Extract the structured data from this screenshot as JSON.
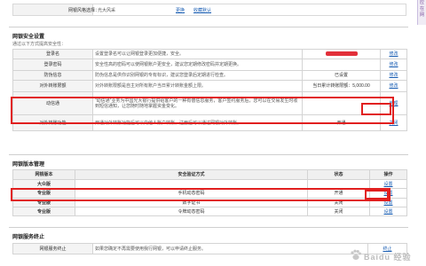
{
  "top": {
    "label": "网银风格选择：",
    "value": "光大风采",
    "link_change": "更换",
    "link_favorites": "收藏默认"
  },
  "sidewidget": {
    "chars": [
      "应",
      "在",
      "网"
    ]
  },
  "security": {
    "title": "网银安全设置",
    "subtitle": "通过以下方式提高安全性：",
    "rows": [
      {
        "label": "登录名",
        "desc": "设置登录名可以让网银登录更加便捷，安全。",
        "status_redacted": true,
        "op": "修改"
      },
      {
        "label": "登录密码",
        "desc": "安全性高的密码可以使网银账户更安全，建议您定期修改密码并定期更换。",
        "status": "",
        "op": "修改"
      },
      {
        "label": "防伪信息",
        "desc": "防伪信息是供你识别网银的专有标识，建议您登录后定期进行检查。",
        "status": "已设置",
        "op": "修改"
      },
      {
        "label": "对外转账限额",
        "desc": "对外转账限额是自主对所有账户当日累计转账金额上限。",
        "status": "当日累计转账限额：5,000.00",
        "op": "修改"
      },
      {
        "label": "动信通",
        "desc": "“动信通”业务为中国光大银行提供给客户的一种有偿信息服务，客户签约服务后，您可以在交易发生时收到短信通知，让您随时随地掌握资金变化。",
        "status": "",
        "op": "管理"
      },
      {
        "label": "对外转账功能",
        "desc": "开通对外转账功能后可以向他人账户转账，注册后可以通过网银对外转账。",
        "status": "开通",
        "op": "关闭"
      }
    ]
  },
  "version": {
    "title": "网银版本管理",
    "headers": [
      "网银版本",
      "安全验证方式",
      "状态",
      "操作"
    ],
    "rows": [
      {
        "name": "大众版",
        "method": "",
        "status": "",
        "op": "设置"
      },
      {
        "name": "专业版",
        "method": "手机动态密码",
        "status": "开通",
        "op": "设置"
      },
      {
        "name": "专业版",
        "method": "数字证书",
        "status": "关闭",
        "op": "设置"
      },
      {
        "name": "专业版",
        "method": "令牌动态密码",
        "status": "关闭",
        "op": "设置"
      }
    ]
  },
  "termination": {
    "title": "网银服务终止",
    "row": {
      "label": "网银服务终止",
      "desc": "如果您确定不再需要使用我行网银，可以申请终止服务。",
      "op": "终止"
    }
  },
  "watermark": {
    "text": "Baidu 经验"
  },
  "colors": {
    "highlight": "#e11f1f",
    "link": "#1a5eb3",
    "redaction": "#e2303a",
    "accent": "#7a4f9c"
  }
}
